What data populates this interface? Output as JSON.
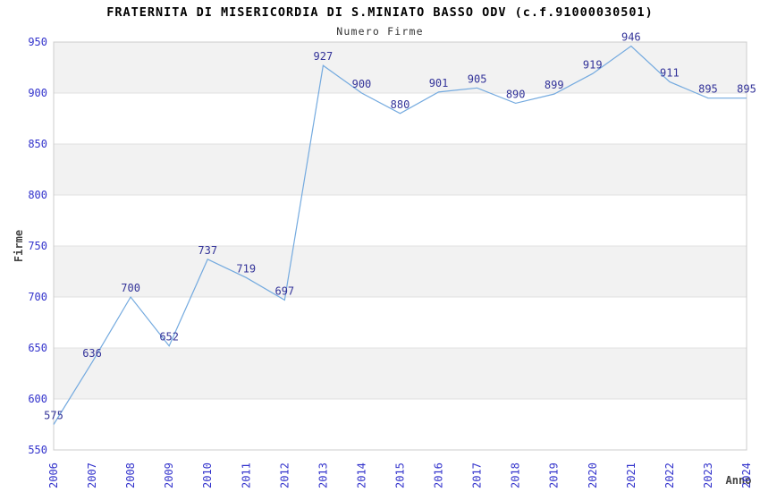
{
  "chart_data": {
    "type": "line",
    "title": "FRATERNITA DI MISERICORDIA DI S.MINIATO BASSO ODV (c.f.91000030501)",
    "subtitle": "Numero Firme",
    "xlabel": "Anno",
    "ylabel": "Firme",
    "categories": [
      2006,
      2007,
      2008,
      2009,
      2010,
      2011,
      2012,
      2013,
      2014,
      2015,
      2016,
      2017,
      2018,
      2019,
      2020,
      2021,
      2022,
      2023,
      2024
    ],
    "values": [
      575,
      636,
      700,
      652,
      737,
      719,
      697,
      927,
      900,
      880,
      901,
      905,
      890,
      899,
      919,
      946,
      911,
      895,
      895
    ],
    "ylim": [
      550,
      950
    ],
    "ytick_step": 50,
    "grid": "horizontal-alternating-bands",
    "legend": "none",
    "point_labels": "shown-above-points",
    "x_tick_rotation": -90,
    "colors": {
      "line": "#74aadf",
      "tick_label": "#3333cc",
      "point_label": "#333399",
      "band_gray": "#f2f2f2",
      "band_white": "#ffffff",
      "gridline": "#e0e0e0",
      "border": "#cccccc",
      "title": "#000000",
      "subtitle": "#333333",
      "axis_title": "#444444",
      "background": "#ffffff"
    }
  }
}
